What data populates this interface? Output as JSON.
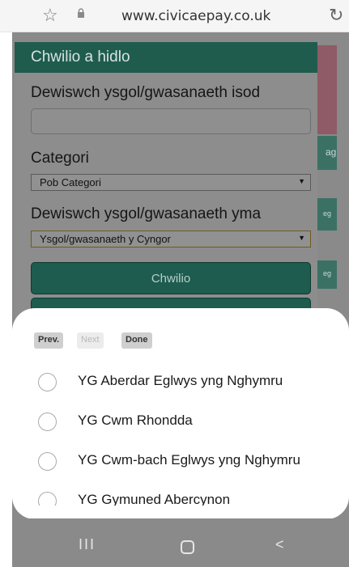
{
  "browser": {
    "url": "www.civicaepay.co.uk"
  },
  "panel": {
    "header": "Chwilio a hidlo",
    "school_label": "Dewiswch ysgol/gwasanaeth isod",
    "search_value": "",
    "category_label": "Categori",
    "category_selected": "Pob Categori",
    "choose_label": "Dewiswch ysgol/gwasanaeth yma",
    "choose_selected": "Ysgol/gwasanaeth y Cyngor",
    "search_button": "Chwilio"
  },
  "background_fragments": {
    "frag1": "ag",
    "frag2": "eg",
    "frag3": "eg"
  },
  "picker": {
    "prev": "Prev.",
    "next": "Next",
    "done": "Done",
    "options": [
      "YG Aberdar Eglwys yng Nghymru",
      "YG Cwm Rhondda",
      "YG Cwm-bach Eglwys yng Nghymru",
      "YG Gymuned Abercynon"
    ]
  },
  "android_nav": {
    "recents": "III",
    "back": "<"
  }
}
